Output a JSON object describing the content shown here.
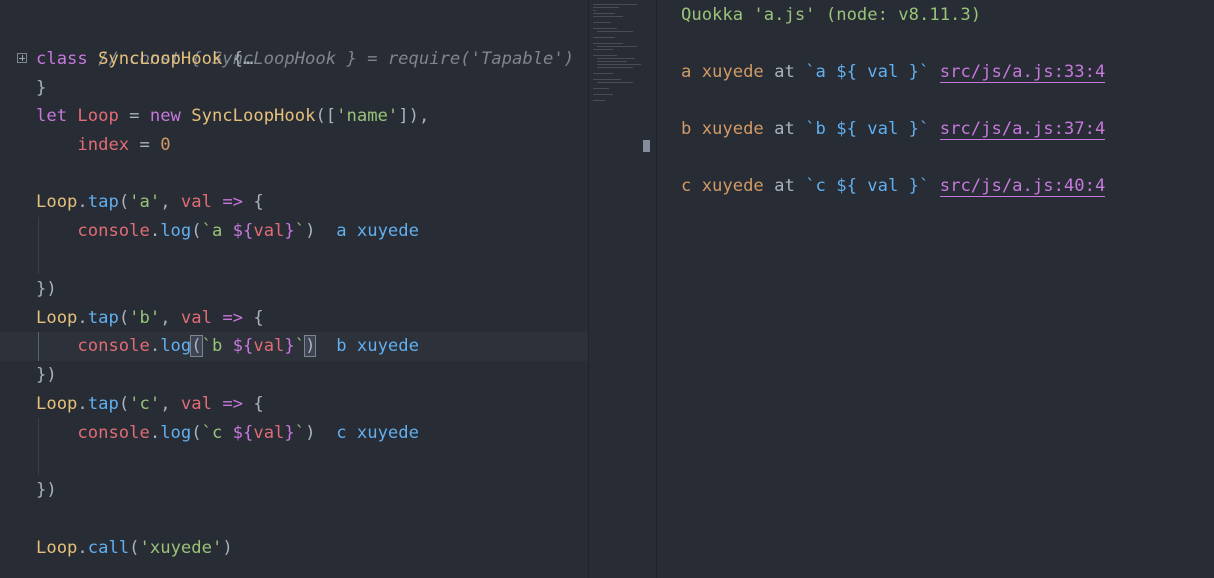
{
  "editor": {
    "lines": {
      "l1": {
        "comment": "// const { SyncLoopHook } = require('Tapable')"
      },
      "l2": {
        "kw": "class",
        "cls": "SyncLoopHook",
        "brace": " {",
        "ellipsis": "…"
      },
      "l3": {
        "brace": "}"
      },
      "l4": {
        "kw": "let",
        "var": "Loop",
        "eq": " = ",
        "kw2": "new",
        "cls": "SyncLoopHook",
        "p1": "([",
        "str": "'name'",
        "p2": "]),"
      },
      "l5": {
        "var": "index",
        "eq": " = ",
        "num": "0"
      },
      "l7": {
        "obj": "Loop",
        "dot": ".",
        "fn": "tap",
        "p1": "(",
        "str": "'a'",
        "comma": ", ",
        "var": "val",
        "arrow": " => ",
        "brace": "{"
      },
      "l8": {
        "obj": "console",
        "dot": ".",
        "fn": "log",
        "p1": "(",
        "tick": "`a ",
        "interp": "${",
        "ivar": "val",
        "close": "}",
        "tick2": "`",
        "p2": ")",
        "result": "a xuyede"
      },
      "l10": {
        "brace": "})"
      },
      "l11": {
        "obj": "Loop",
        "dot": ".",
        "fn": "tap",
        "p1": "(",
        "str": "'b'",
        "comma": ", ",
        "var": "val",
        "arrow": " => ",
        "brace": "{"
      },
      "l12": {
        "obj": "console",
        "dot": ".",
        "fn": "log",
        "p1": "(",
        "tick": "`b ",
        "interp": "${",
        "ivar": "val",
        "close": "}",
        "tick2": "`",
        "p2": ")",
        "result": "b xuyede"
      },
      "l13": {
        "brace": "})"
      },
      "l14": {
        "obj": "Loop",
        "dot": ".",
        "fn": "tap",
        "p1": "(",
        "str": "'c'",
        "comma": ", ",
        "var": "val",
        "arrow": " => ",
        "brace": "{"
      },
      "l15": {
        "obj": "console",
        "dot": ".",
        "fn": "log",
        "p1": "(",
        "tick": "`c ",
        "interp": "${",
        "ivar": "val",
        "close": "}",
        "tick2": "`",
        "p2": ")",
        "result": "c xuyede"
      },
      "l17": {
        "brace": "})"
      },
      "l19": {
        "obj": "Loop",
        "dot": ".",
        "fn": "call",
        "p1": "(",
        "str": "'xuyede'",
        "p2": ")"
      }
    }
  },
  "output": {
    "title": "Quokka 'a.js' (node: v8.11.3)",
    "entries": [
      {
        "value": "a xuyede",
        "at": " at ",
        "expr": "`a ${ val }`",
        "link": "src/js/a.js:33:4"
      },
      {
        "value": "b xuyede",
        "at": " at ",
        "expr": "`b ${ val }`",
        "link": "src/js/a.js:37:4"
      },
      {
        "value": "c xuyede",
        "at": " at ",
        "expr": "`c ${ val }`",
        "link": "src/js/a.js:40:4"
      }
    ]
  },
  "colors": {
    "background": "#282c34",
    "keyword": "#c678dd",
    "class": "#e5c07b",
    "variable": "#e06c75",
    "function": "#61afef",
    "string": "#98c379",
    "number": "#d19a66",
    "comment": "#7f848e",
    "result": "#56b6c2"
  }
}
